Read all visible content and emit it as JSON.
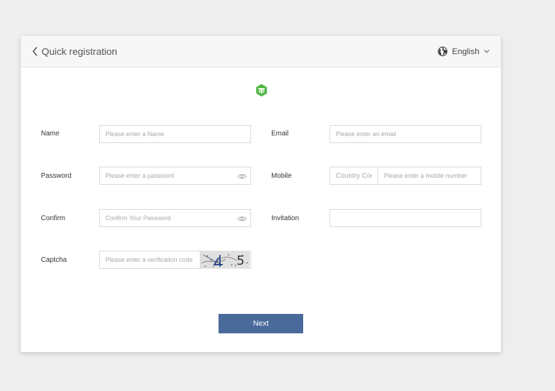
{
  "header": {
    "title": "Quick registration",
    "language": "English"
  },
  "form": {
    "name": {
      "label": "Name",
      "placeholder": "Please enter a Name",
      "value": ""
    },
    "email": {
      "label": "Email",
      "placeholder": "Please enter an email",
      "value": ""
    },
    "password": {
      "label": "Password",
      "placeholder": "Please enter a password",
      "value": ""
    },
    "mobile": {
      "label": "Mobile",
      "country_code_placeholder": "Country Code",
      "placeholder": "Please enter a mobile number",
      "value": ""
    },
    "confirm": {
      "label": "Confirm",
      "placeholder": "Confirm Your Password",
      "value": ""
    },
    "invitation": {
      "label": "Invitation",
      "placeholder": "",
      "value": ""
    },
    "captcha": {
      "label": "Captcha",
      "placeholder": "Please enter a verification code",
      "value": ""
    }
  },
  "actions": {
    "next_label": "Next"
  },
  "icons": {
    "back": "chevron-left-icon",
    "language": "globe-icon",
    "dropdown": "chevron-down-icon",
    "logo": "brand-logo",
    "password_toggle": "eye-icon"
  },
  "colors": {
    "primary_button": "#4a6a9c",
    "logo_green": "#52b847",
    "page_background": "#eeeeee",
    "header_background": "#f7f7f7"
  }
}
